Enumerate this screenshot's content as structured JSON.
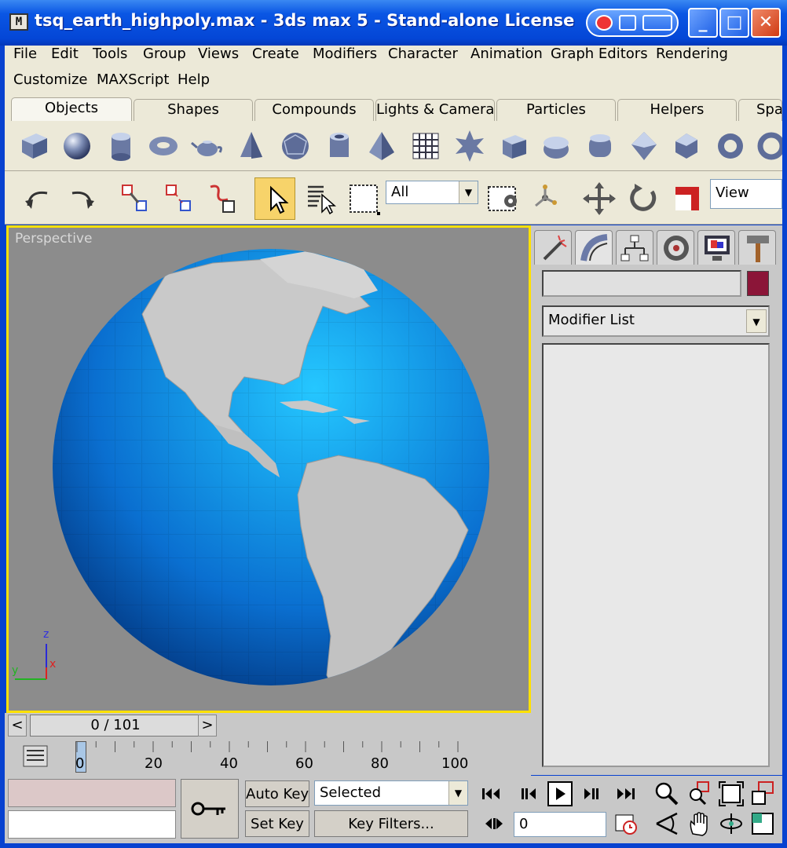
{
  "window": {
    "title": "tsq_earth_highpoly.max - 3ds max 5 - Stand-alone License",
    "icon": "app-icon"
  },
  "menu": [
    "File",
    "Edit",
    "Tools",
    "Group",
    "Views",
    "Create",
    "Modifiers",
    "Character",
    "Animation",
    "Graph Editors",
    "Rendering",
    "Customize",
    "MAXScript",
    "Help"
  ],
  "tabs": [
    "Objects",
    "Shapes",
    "Compounds",
    "Lights & Cameras",
    "Particles",
    "Helpers",
    "Spa"
  ],
  "active_tab": "Objects",
  "shelf_icons": [
    "box",
    "sphere",
    "cylinder",
    "torus",
    "teapot",
    "cone",
    "geosphere",
    "tube",
    "pyramid",
    "plane",
    "hedra",
    "chamfer-box",
    "oil-tank",
    "spindle",
    "gengon",
    "ring-wave",
    "torus-knot"
  ],
  "main_toolbar": {
    "selection_filter": "All",
    "coord_system": "View"
  },
  "viewport": {
    "label": "Perspective",
    "axis_x": "x",
    "axis_y": "y",
    "axis_z": "z"
  },
  "command_panel": {
    "tabs": [
      "create",
      "modify",
      "hierarchy",
      "motion",
      "display",
      "utilities"
    ],
    "active_tab": "modify",
    "object_color": "#8b1538",
    "modifier_list": "Modifier List"
  },
  "timeline": {
    "frame_display": "0 / 101",
    "ticks": [
      "0",
      "20",
      "40",
      "60",
      "80",
      "100"
    ],
    "prev": "<",
    "next": ">"
  },
  "animation": {
    "auto_key": "Auto Key",
    "set_key": "Set Key",
    "key_mode": "Selected",
    "key_filters": "Key Filters...",
    "current_frame": "0"
  },
  "colors": {
    "viewport_border": "#ffe100",
    "ocean": "#1a86f0",
    "land": "#c8c8c8"
  }
}
